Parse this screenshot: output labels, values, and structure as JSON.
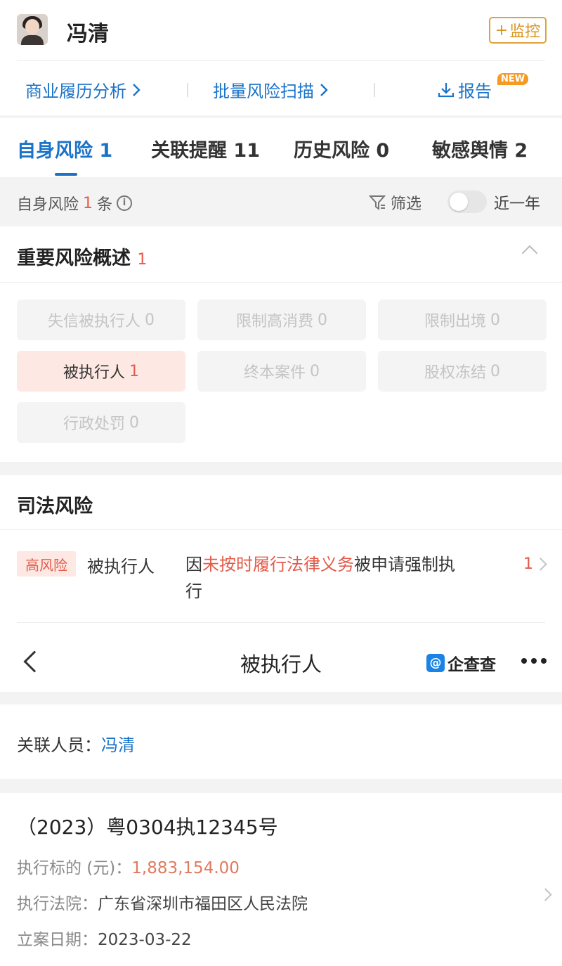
{
  "profile": {
    "name": "冯清",
    "monitor_label": "监控"
  },
  "quick_links": {
    "business_history": "商业履历分析",
    "batch_scan": "批量风险扫描",
    "report": "报告",
    "new_badge": "NEW"
  },
  "tabs": [
    {
      "label": "自身风险",
      "count": "1",
      "active": true
    },
    {
      "label": "关联提醒",
      "count": "11",
      "active": false
    },
    {
      "label": "历史风险",
      "count": "0",
      "active": false
    },
    {
      "label": "敏感舆情",
      "count": "2",
      "active": false
    }
  ],
  "filter_bar": {
    "prefix": "自身风险",
    "count": "1",
    "suffix": "条",
    "filter_label": "筛选",
    "toggle_label": "近一年",
    "toggle_on": false
  },
  "overview": {
    "title": "重要风险概述",
    "count": "1",
    "chips": [
      {
        "label": "失信被执行人",
        "count": "0"
      },
      {
        "label": "限制高消费",
        "count": "0"
      },
      {
        "label": "限制出境",
        "count": "0"
      },
      {
        "label": "被执行人",
        "count": "1"
      },
      {
        "label": "终本案件",
        "count": "0"
      },
      {
        "label": "股权冻结",
        "count": "0"
      },
      {
        "label": "行政处罚",
        "count": "0"
      }
    ]
  },
  "judicial": {
    "title": "司法风险",
    "item": {
      "tag": "高风险",
      "type": "被执行人",
      "desc_prefix": "因",
      "desc_highlight": "未按时履行法律义务",
      "desc_suffix": "被申请强制执行",
      "count": "1"
    }
  },
  "detail_nav": {
    "title": "被执行人",
    "brand": "企查查"
  },
  "related": {
    "label": "关联人员：",
    "value": "冯清"
  },
  "case": {
    "number": "（2023）粤0304执12345号",
    "amount_label": "执行标的 (元)：",
    "amount": "1,883,154.00",
    "court_label": "执行法院：",
    "court": "广东省深圳市福田区人民法院",
    "date_label": "立案日期：",
    "date": "2023-03-22"
  },
  "colors": {
    "accent_blue": "#1a73c8",
    "risk_red": "#e45b4a",
    "monitor_orange": "#e3a13a",
    "new_badge_orange": "#f59a23"
  }
}
